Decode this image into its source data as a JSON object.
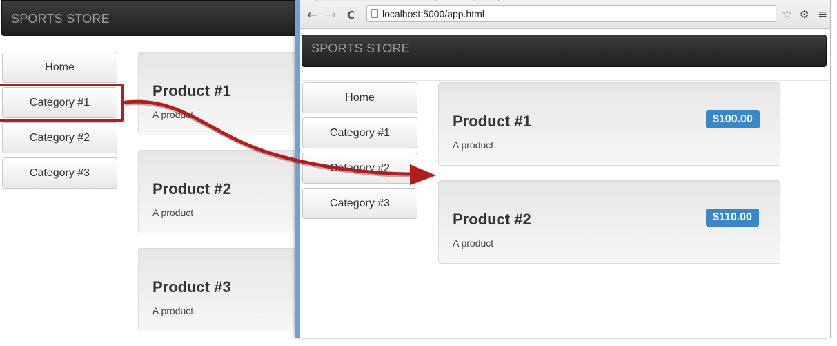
{
  "back_window": {
    "brand": "SPORTS STORE",
    "categories": [
      "Home",
      "Category #1",
      "Category #2",
      "Category #3"
    ],
    "products": [
      {
        "title": "Product #1",
        "desc": "A product"
      },
      {
        "title": "Product #2",
        "desc": "A product"
      },
      {
        "title": "Product #3",
        "desc": "A product"
      }
    ]
  },
  "browser": {
    "url": "localhost:5000/app.html",
    "back_glyph": "←",
    "forward_glyph": "→",
    "reload_glyph": "C",
    "star_glyph": "☆",
    "ext_glyph": "⚙",
    "menu_glyph": "≡"
  },
  "front_window": {
    "brand": "SPORTS STORE",
    "categories": [
      "Home",
      "Category #1",
      "Category #2",
      "Category #3"
    ],
    "products": [
      {
        "title": "Product #1",
        "desc": "A product",
        "price": "$100.00"
      },
      {
        "title": "Product #2",
        "desc": "A product",
        "price": "$110.00"
      }
    ]
  },
  "colors": {
    "highlight": "#b01f1f",
    "arrow": "#b01f1f",
    "price_badge": "#3a87c8",
    "browser_frame": "#6fa0dc"
  }
}
